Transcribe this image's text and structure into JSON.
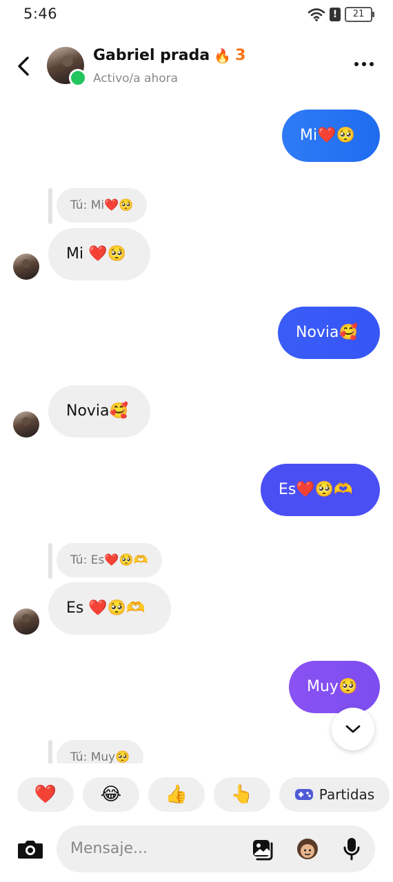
{
  "status_bar": {
    "time": "5:46",
    "battery": "21"
  },
  "header": {
    "contact_name": "Gabriel prada",
    "streak_emoji": "🔥",
    "streak_count": "3",
    "status": "Activo/a ahora"
  },
  "messages": [
    {
      "text": "Mi❤️🥺",
      "colors": [
        "#2f7bf6",
        "#1f6cf0"
      ]
    },
    {
      "reply_to": "Tú: Mi❤️🥺",
      "text": "Mi ❤️🥺"
    },
    {
      "text": "Novia🥰",
      "colors": [
        "#3a5cf6",
        "#3656f5"
      ]
    },
    {
      "text": "Novia🥰"
    },
    {
      "text": "Es❤️🥺🫶",
      "colors": [
        "#4a4ff4",
        "#4a4ff4"
      ]
    },
    {
      "reply_to": "Tú: Es❤️🥺🫶",
      "text": "Es ❤️🥺🫶"
    },
    {
      "text": "Muy🥺",
      "colors": [
        "#8a52f2",
        "#7c4df0"
      ]
    },
    {
      "reply_to": "Tú: Muy🥺"
    }
  ],
  "quick_replies": [
    "❤️",
    "😂",
    "👍",
    "👆"
  ],
  "games_button": {
    "icon": "gamepad-icon",
    "label": "Partidas"
  },
  "composer": {
    "placeholder": "Mensaje..."
  },
  "colors": {
    "online": "#22c55e",
    "streak": "#f97316",
    "incoming_bubble": "#efefef"
  }
}
